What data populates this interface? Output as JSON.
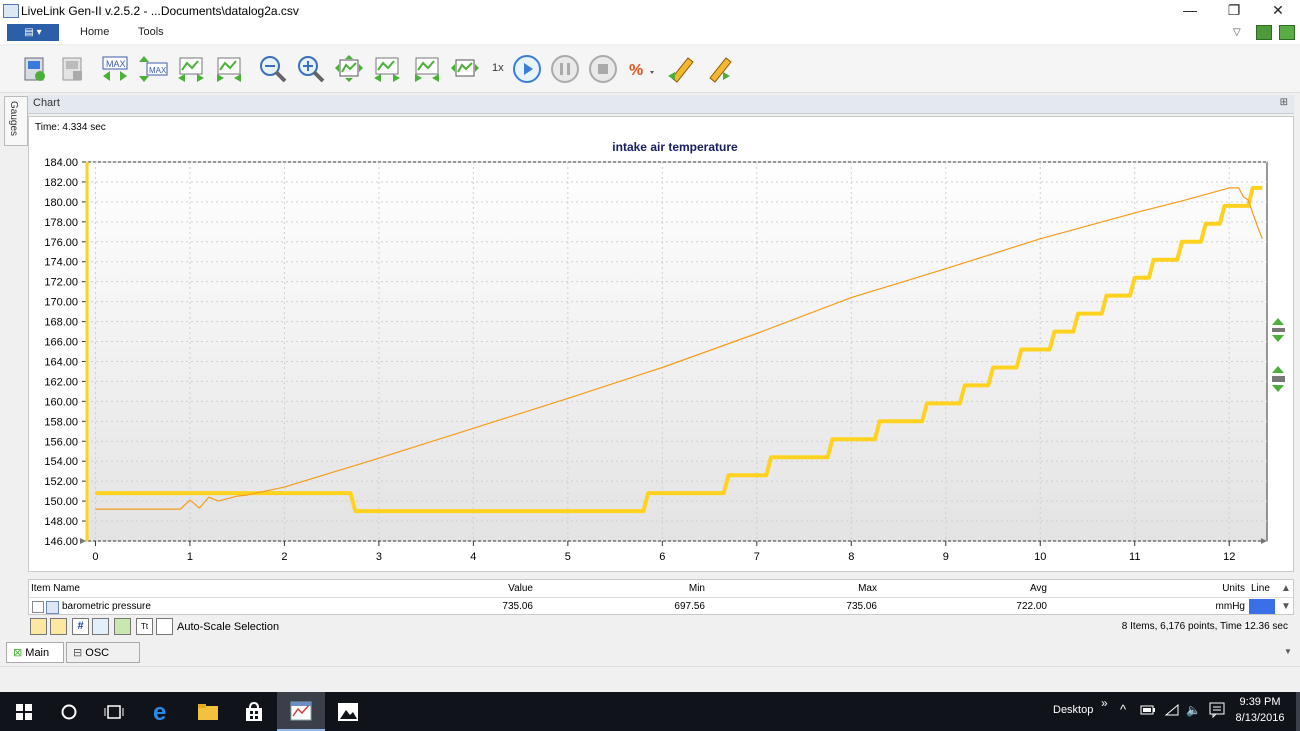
{
  "window": {
    "title": "LiveLink Gen-II  v.2.5.2 - ...Documents\\datalog2a.csv",
    "min": "—",
    "max": "❐",
    "close": "✕"
  },
  "ribbon": {
    "file_label": "▤ ▾",
    "tabs": [
      "Home",
      "Tools"
    ]
  },
  "toolbar": {
    "speed_label": "1x",
    "max_label": "MAX"
  },
  "side_tabs": {
    "gauges": "Gauges"
  },
  "chart_panel": {
    "title": "Chart",
    "pin": "⊞",
    "time_label": "Time: 4.334 sec"
  },
  "chart_data": {
    "type": "line",
    "title": "intake air temperature",
    "xlabel": "",
    "ylabel": "",
    "xlim": [
      -0.1,
      12.4
    ],
    "ylim": [
      146,
      184
    ],
    "x_ticks": [
      "0",
      "1",
      "2",
      "3",
      "4",
      "5",
      "6",
      "7",
      "8",
      "9",
      "10",
      "11",
      "12"
    ],
    "y_ticks": [
      "146.00",
      "148.00",
      "150.00",
      "152.00",
      "154.00",
      "156.00",
      "158.00",
      "160.00",
      "162.00",
      "164.00",
      "166.00",
      "168.00",
      "170.00",
      "172.00",
      "174.00",
      "176.00",
      "178.00",
      "180.00",
      "182.00",
      "184.00"
    ],
    "grid": true,
    "series": [
      {
        "color": "#ffd21f",
        "x": [
          0,
          2.7,
          2.75,
          5.8,
          5.85,
          6.65,
          6.7,
          7.1,
          7.15,
          7.75,
          7.8,
          8.25,
          8.3,
          8.75,
          8.8,
          9.15,
          9.2,
          9.45,
          9.5,
          9.75,
          9.8,
          10.1,
          10.15,
          10.35,
          10.4,
          10.65,
          10.7,
          10.95,
          11,
          11.15,
          11.2,
          11.45,
          11.5,
          11.7,
          11.75,
          11.9,
          11.95,
          12.2,
          12.25,
          12.35
        ],
        "values": [
          150.8,
          150.8,
          149,
          149,
          150.8,
          150.8,
          152.6,
          152.6,
          154.4,
          154.4,
          156.2,
          156.2,
          158,
          158,
          159.8,
          159.8,
          161.6,
          161.6,
          163.4,
          163.4,
          165.2,
          165.2,
          167,
          167,
          168.8,
          168.8,
          170.6,
          170.6,
          172.4,
          172.4,
          174.2,
          174.2,
          176,
          176,
          177.8,
          177.8,
          179.6,
          179.6,
          181.4,
          181.4
        ]
      },
      {
        "color": "#f59b1d",
        "x": [
          0,
          0.9,
          1.0,
          1.1,
          1.2,
          1.3,
          1.5,
          1.6,
          2,
          3,
          4,
          5,
          6,
          7,
          8,
          9,
          10,
          11,
          11.5,
          12,
          12.1,
          12.15,
          12.2,
          12.3,
          12.35
        ],
        "values": [
          149.2,
          149.2,
          150.1,
          149.3,
          150.4,
          150,
          150.5,
          150.6,
          151.4,
          154.3,
          157.3,
          160.3,
          163.4,
          166.8,
          170.4,
          173.3,
          176.3,
          178.9,
          180.1,
          181.4,
          181.4,
          180.5,
          180.2,
          177.5,
          176.3
        ]
      }
    ]
  },
  "table": {
    "headers": {
      "item": "Item Name",
      "value": "Value",
      "min": "Min",
      "max": "Max",
      "avg": "Avg",
      "units": "Units",
      "line": "Line"
    },
    "row": {
      "name": "barometric pressure",
      "value": "735.06",
      "min": "697.56",
      "max": "735.06",
      "avg": "722.00",
      "units": "mmHg"
    },
    "line_color": "#3b6fe8"
  },
  "table_toolbar": {
    "autoscale": "Auto-Scale Selection",
    "summary": "8 Items, 6,176 points, Time 12.36 sec"
  },
  "bottom_tabs": {
    "main": "Main",
    "osc": "OSC"
  },
  "taskbar": {
    "desktop": "Desktop",
    "time": "9:39 PM",
    "date": "8/13/2016"
  }
}
